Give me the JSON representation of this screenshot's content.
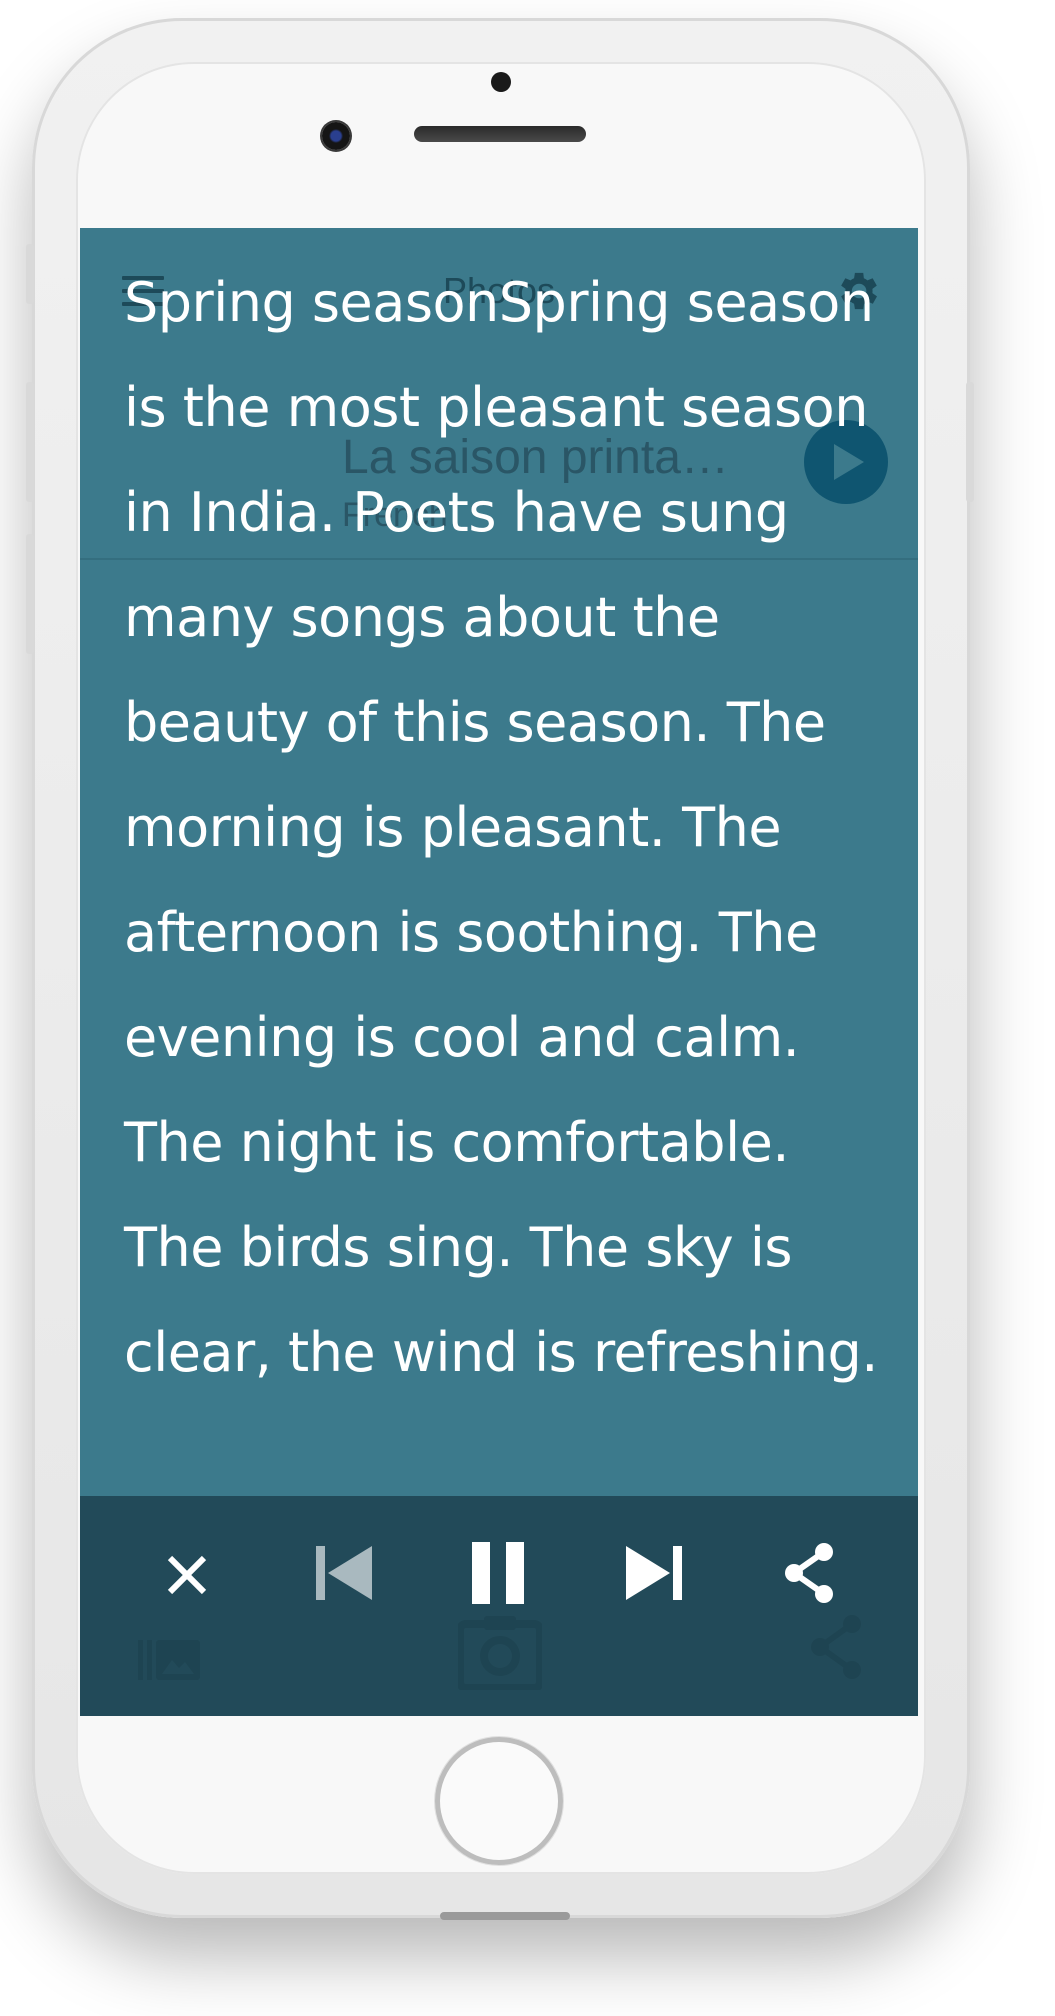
{
  "app": {
    "title": "Photos"
  },
  "item": {
    "title": "La saison printa…",
    "subtitle": "French"
  },
  "reading": {
    "text": "Spring seasonSpring season is the most pleasant season in India. Poets have sung many songs about the beauty of this season. The morning is pleasant. The afternoon is soothing. The evening is cool and calm. The night is comfortable. The birds sing. The sky is clear, the wind is refreshing."
  },
  "icons": {
    "menu": "menu-icon",
    "settings": "gear-icon",
    "play": "play-icon",
    "gallery": "gallery-icon",
    "camera": "camera-icon",
    "share": "share-icon",
    "close": "close-icon",
    "previous": "skip-previous-icon",
    "pause": "pause-icon",
    "next": "skip-next-icon"
  },
  "colors": {
    "screen_bg": "#3c7a8c",
    "bottom_bar": "#234a59",
    "play_button": "#0f5570",
    "text": "#ffffff"
  }
}
